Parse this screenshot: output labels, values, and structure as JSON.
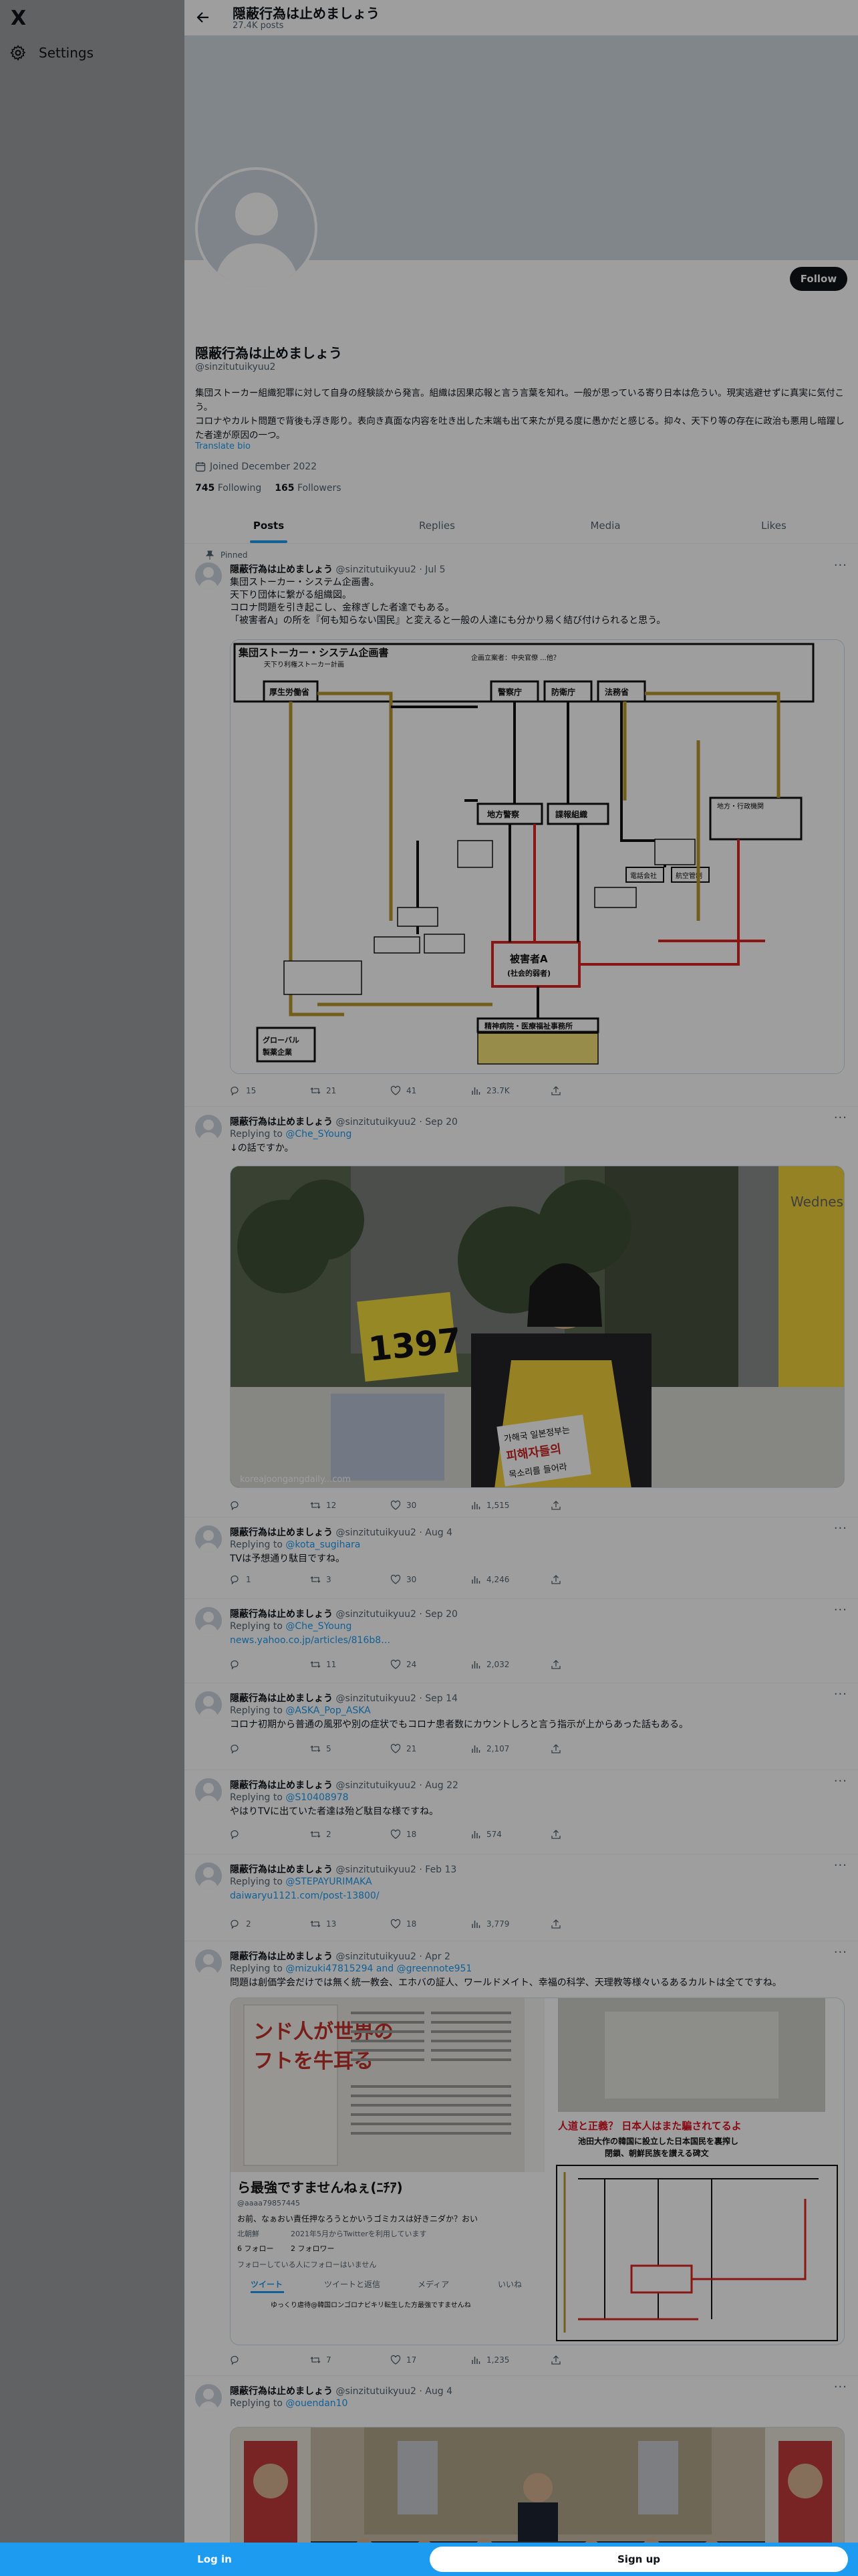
{
  "sidebar": {
    "logo": "X",
    "settings_label": "Settings"
  },
  "header": {
    "title": "隠蔽行為は止めましょう",
    "post_count": "27.4K posts"
  },
  "profile": {
    "follow_label": "Follow",
    "name": "隠蔽行為は止めましょう",
    "handle": "@sinzitutuikyuu2",
    "bio_line1": "集団ストーカー組織犯罪に対して自身の経験談から発言。組織は因果応報と言う言葉を知れ。一般が思っている寄り日本は危うい。現実逃避せずに真実に気付こう。",
    "bio_line2": "コロナやカルト問題で背後も浮き彫り。表向き真面な内容を吐き出した末端も出て来たが見る度に愚かだと感じる。抑々、天下り等の存在に政治も悪用し暗躍した者達が原因の一つ。",
    "translate": "Translate bio",
    "joined": "Joined December 2022",
    "following_count": "745",
    "following_label": "Following",
    "followers_count": "165",
    "followers_label": "Followers"
  },
  "tabs": [
    "Posts",
    "Replies",
    "Media",
    "Likes"
  ],
  "tweets": [
    {
      "pinned": "Pinned",
      "name": "隠蔽行為は止めましょう",
      "handle": "@sinzitutuikyuu2",
      "date": "· Jul 5",
      "line1": "集団ストーカー・システム企画書。",
      "line2": "天下り団体に繋がる組織図。",
      "line3": "コロナ問題を引き起こし、金稼ぎした者達でもある。",
      "line4": "「被害者A」の所を『何も知らない国民』と変えると一般の人達にも分かり易く結び付けられると思う。",
      "replies": "15",
      "reposts": "21",
      "likes": "41",
      "views": "23.7K"
    },
    {
      "name": "隠蔽行為は止めましょう",
      "handle": "@sinzitutuikyuu2",
      "date": "· Sep 20",
      "replying": "Replying to",
      "to": "@Che_SYoung",
      "text": "↓の話ですか。",
      "replies": "",
      "reposts": "12",
      "likes": "30",
      "views": "1,515"
    },
    {
      "name": "隠蔽行為は止めましょう",
      "handle": "@sinzitutuikyuu2",
      "date": "· Aug 4",
      "replying": "Replying to",
      "to": "@kota_sugihara",
      "text": "TVは予想通り駄目ですね。",
      "replies": "1",
      "reposts": "3",
      "likes": "30",
      "views": "4,246"
    },
    {
      "name": "隠蔽行為は止めましょう",
      "handle": "@sinzitutuikyuu2",
      "date": "· Sep 20",
      "replying": "Replying to",
      "to": "@Che_SYoung",
      "text": "news.yahoo.co.jp/articles/816b8…",
      "replies": "",
      "reposts": "11",
      "likes": "24",
      "views": "2,032"
    },
    {
      "name": "隠蔽行為は止めましょう",
      "handle": "@sinzitutuikyuu2",
      "date": "· Sep 14",
      "replying": "Replying to",
      "to": "@ASKA_Pop_ASKA",
      "text": "コロナ初期から普通の風邪や別の症状でもコロナ患者数にカウントしろと言う指示が上からあった話もある。",
      "replies": "",
      "reposts": "5",
      "likes": "21",
      "views": "2,107"
    },
    {
      "name": "隠蔽行為は止めましょう",
      "handle": "@sinzitutuikyuu2",
      "date": "· Aug 22",
      "replying": "Replying to",
      "to": "@S10408978",
      "text": "やはりTVに出ていた者達は殆ど駄目な様ですね。",
      "replies": "",
      "reposts": "2",
      "likes": "18",
      "views": "574"
    },
    {
      "name": "隠蔽行為は止めましょう",
      "handle": "@sinzitutuikyuu2",
      "date": "· Feb 13",
      "replying": "Replying to",
      "to": "@STEPAYURIMAKA",
      "text": "daiwaryu1121.com/post-13800/",
      "replies": "2",
      "reposts": "13",
      "likes": "18",
      "views": "3,779"
    },
    {
      "name": "隠蔽行為は止めましょう",
      "handle": "@sinzitutuikyuu2",
      "date": "· Apr 2",
      "replying": "Replying to",
      "to": "@mizuki47815294 and @greennote951",
      "text": "問題は創価学会だけでは無く統一教会、エホバの証人、ワールドメイト、幸福の科学、天理教等様々いるあるカルトは全てですね。",
      "replies": "",
      "reposts": "7",
      "likes": "17",
      "views": "1,235"
    },
    {
      "name": "隠蔽行為は止めましょう",
      "handle": "@sinzitutuikyuu2",
      "date": "· Aug 4",
      "replying": "Replying to",
      "to": "@ouendan10"
    }
  ],
  "chart_img": {
    "title": "集団ストーカー・システム企画書",
    "subtitle": "天下り利権ストーカー計画",
    "top_label": "企画立案者：中央官僚 ...他？",
    "b1": "厚生労働省",
    "b2": "警察庁",
    "b3": "防衛庁",
    "b4": "法務省",
    "b5": "地方警察",
    "b6": "諜報組織",
    "b7": "被害者A",
    "b8": "(社会的弱者)",
    "b9": "グローバル製薬企業",
    "b10": "精神病院・医療福祉事務所",
    "b11": "地方・行政機関",
    "b12": "電話会社",
    "b13": "航空管制"
  },
  "photo1": {
    "number": "1397",
    "right_text": "Wednes",
    "caption": "koreajoongangdaily...com",
    "sign1": "가해국 일본정부는",
    "sign2": "피해자들의",
    "sign3": "목소리를 들어라"
  },
  "news_img": {
    "vert1": "ンド人が世界の",
    "vert2": "フトを牛耳る",
    "left_title": "ら最強ですませんねぇ(ﾆﾁｱ)",
    "left_handle": "@aaaa79857445",
    "left_text": "お前、なぁおい責任押なろうとかいうゴミカスは好きニダか？おい",
    "left_loc": "北朝鮮",
    "left_joined": "2021年5月からTwitterを利用しています",
    "left_following": "6 フォロー",
    "left_followers": "2 フォロワー",
    "left_note": "フォローしている人にフォローはいません",
    "left_tabs": [
      "ツイート",
      "ツイートと返信",
      "メディア",
      "いいね"
    ],
    "left_tweet": "ゆっくり虐待@韓国ロンゴロナビキリ転生した方最強ですませんね",
    "right_title": "人道と正義？ 日本人はまた騙されてるよ",
    "right_sub1": "池田大作の韓国に設立した日本国民を裏搾し",
    "right_sub2": "閉鎖、朝鮮民族を讃える碑文"
  },
  "photo2": {
    "caption": ""
  },
  "bottom": {
    "login": "Log in",
    "signup": "Sign up"
  }
}
